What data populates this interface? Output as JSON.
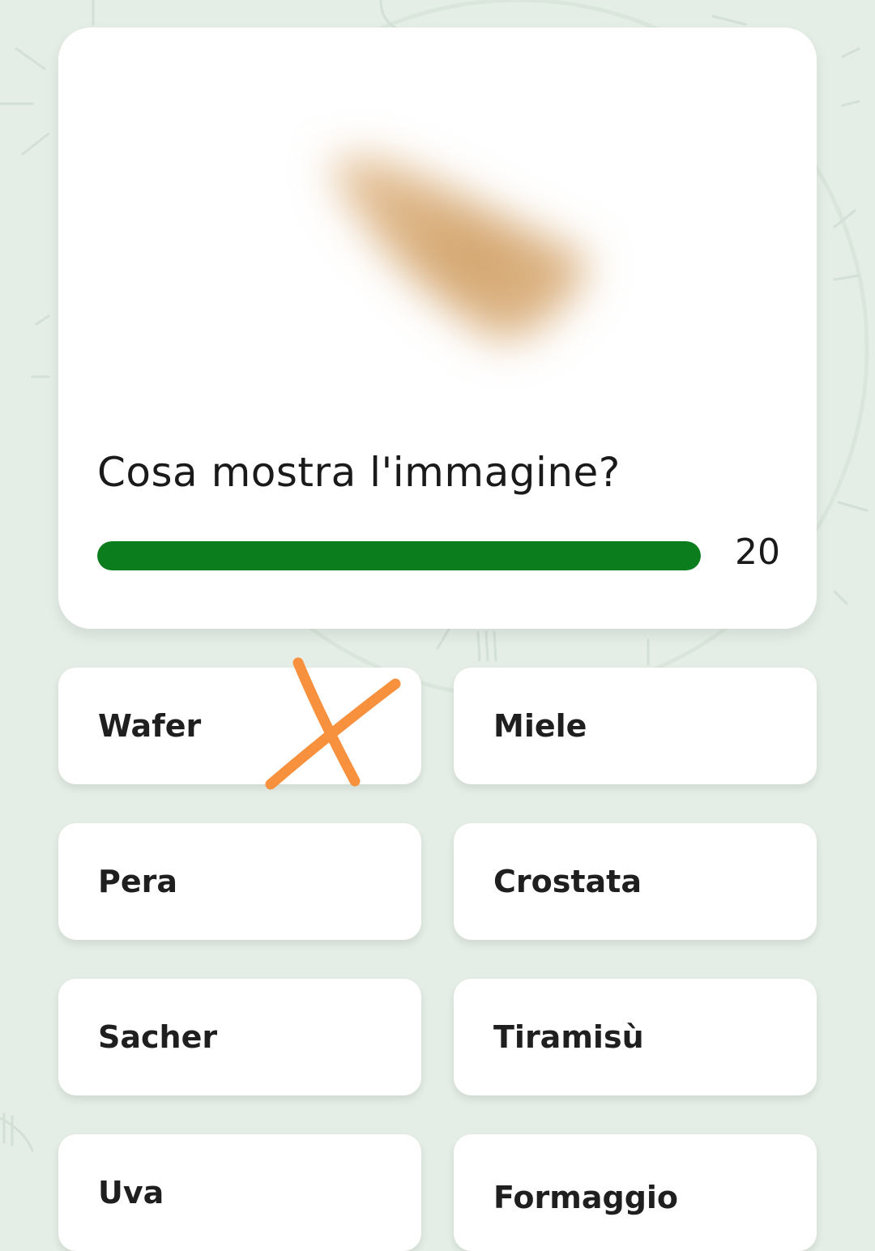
{
  "question": {
    "text": "Cosa mostra l'immagine?",
    "image_icon": "blurred-food-image"
  },
  "timer": {
    "value": "20",
    "progress_fraction": 1.0,
    "color": "#0b7d1c"
  },
  "answers": [
    {
      "label": "Wafer"
    },
    {
      "label": "Miele"
    },
    {
      "label": "Pera"
    },
    {
      "label": "Crostata"
    },
    {
      "label": "Sacher"
    },
    {
      "label": "Tiramisù"
    },
    {
      "label": "Uva"
    },
    {
      "label": "Formaggio"
    }
  ],
  "annotation": {
    "icon": "cross-icon",
    "color": "#f7913d"
  },
  "colors": {
    "background": "#e4ede6",
    "card": "#ffffff",
    "progress": "#0b7d1c"
  }
}
